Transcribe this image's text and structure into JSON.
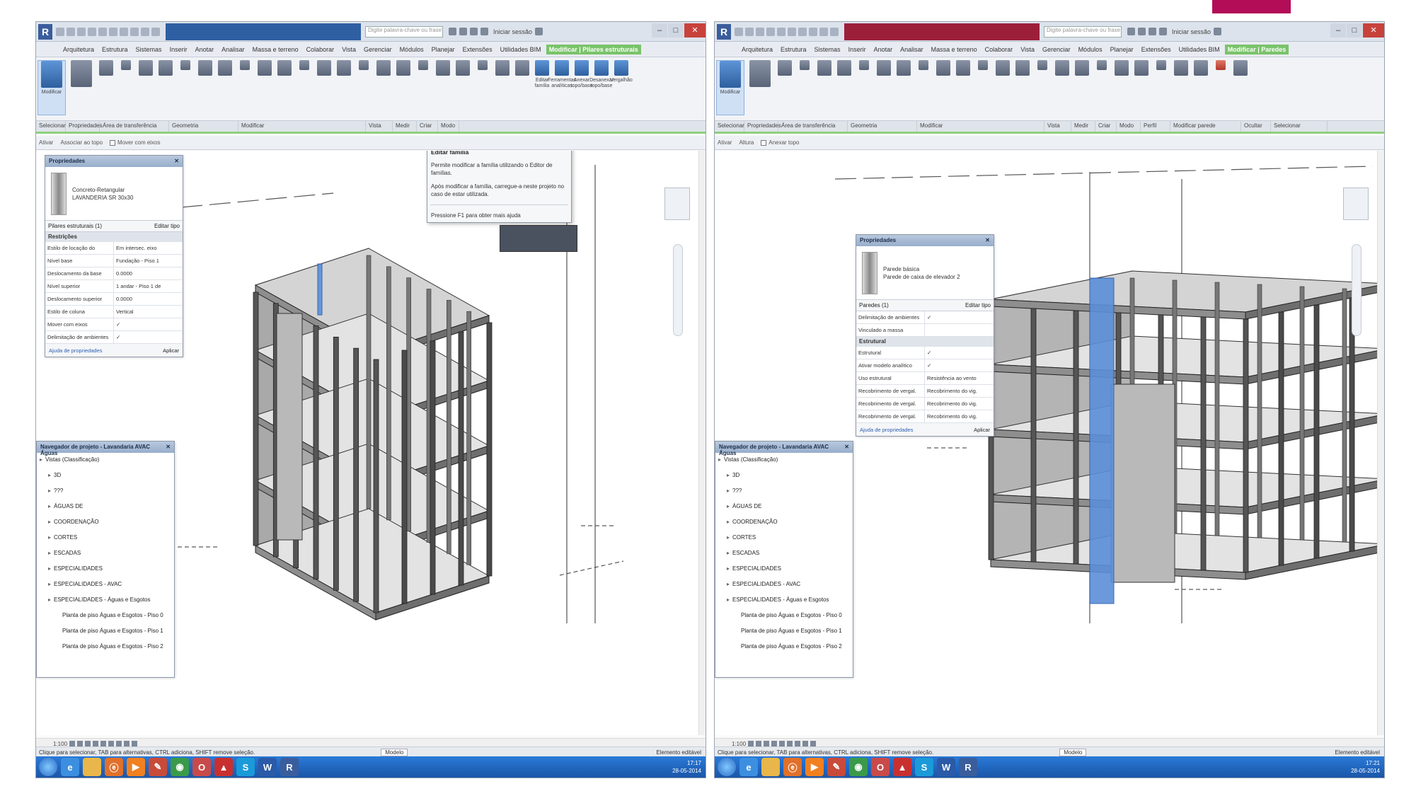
{
  "colors": {
    "accent_rect": "#b30d57",
    "doc_title_left": "#2f5fa3",
    "doc_title_right": "#9c1f3a",
    "selected_blue": "#5b8fd9",
    "context_tab": "#7ac36a"
  },
  "left": {
    "window": {
      "doc_title": "",
      "search_placeholder": "Digite palavra-chave ou frase",
      "user": "Iniciar sessão"
    },
    "ribbon": {
      "tabs": [
        "Arquitetura",
        "Estrutura",
        "Sistemas",
        "Inserir",
        "Anotar",
        "Analisar",
        "Massa e terreno",
        "Colaborar",
        "Vista",
        "Gerenciar",
        "Módulos",
        "Planejar",
        "Extensões",
        "Utilidades BIM",
        "Modificar | Pilares estruturais"
      ],
      "panels": [
        "Selecionar",
        "Propriedades",
        "Área de transferência",
        "Geometria",
        "Modificar",
        "Vista",
        "Medir",
        "Criar",
        "Modo"
      ],
      "tools": {
        "modify": "Modificar",
        "edit_family": "Editar família",
        "edit_analytical": "Ferramentas analíticas",
        "attach_base": "Anexar topo/base",
        "detach_base": "Desanexar topo/base",
        "hangers": "Vergalhão"
      }
    },
    "options_bar": {
      "ctx1": "Ativar",
      "ctx2": "Associar ao topo",
      "check": "Mover com eixos"
    },
    "properties": {
      "title": "Propriedades",
      "type_name_line1": "Concreto-Retangular",
      "type_name_line2": "LAVANDERIA SR 30x30",
      "filter_label": "Pilares estruturais (1)",
      "edit_type": "Editar tipo",
      "section": "Restrições",
      "rows": [
        {
          "k": "Estilo de locação do",
          "v": "Em intersec. eixo"
        },
        {
          "k": "Nível base",
          "v": "Fundação - Piso 1"
        },
        {
          "k": "Deslocamento da base",
          "v": "0.0000"
        },
        {
          "k": "Nível superior",
          "v": "1 andar - Piso 1 de"
        },
        {
          "k": "Deslocamento superior",
          "v": "0.0000"
        },
        {
          "k": "Estilo de coluna",
          "v": "Vertical"
        },
        {
          "k": "Mover com eixos",
          "v": "✓"
        },
        {
          "k": "Delimitação de ambientes",
          "v": "✓"
        }
      ],
      "help_link": "Ajuda de propriedades",
      "apply": "Aplicar"
    },
    "browser": {
      "title": "Navegador de projeto - Lavandaria AVAC Águas",
      "items": [
        {
          "indent": 0,
          "label": "Vistas (Classificação)"
        },
        {
          "indent": 1,
          "label": "3D"
        },
        {
          "indent": 1,
          "label": "???"
        },
        {
          "indent": 1,
          "label": "ÁGUAS DE"
        },
        {
          "indent": 1,
          "label": "COORDENAÇÃO"
        },
        {
          "indent": 1,
          "label": "CORTES"
        },
        {
          "indent": 1,
          "label": "ESCADAS"
        },
        {
          "indent": 1,
          "label": "ESPECIALIDADES"
        },
        {
          "indent": 1,
          "label": "ESPECIALIDADES - AVAC"
        },
        {
          "indent": 1,
          "label": "ESPECIALIDADES - Águas e Esgotos"
        },
        {
          "indent": 2,
          "label": "Planta de piso Águas e Esgotos - Piso 0"
        },
        {
          "indent": 2,
          "label": "Planta de piso Águas e Esgotos - Piso 1"
        },
        {
          "indent": 2,
          "label": "Planta de piso Águas e Esgotos - Piso 2"
        }
      ]
    },
    "tooltip": {
      "title": "Editar família",
      "line1": "Permite modificar a família utilizando o Editor de famílias.",
      "line2": "Após modificar a família, carregue-a neste projeto no caso de estar utilizada.",
      "line3": "Pressione F1 para obter mais ajuda"
    },
    "status": {
      "text": "Clique para selecionar, TAB para alternativas, CTRL adiciona, SHIFT remove seleção.",
      "model": "Modelo",
      "filter": "Elemento editável"
    },
    "clock": {
      "time": "17:17",
      "date": "28-05-2014"
    }
  },
  "right": {
    "window": {
      "doc_title": "",
      "search_placeholder": "Digite palavra-chave ou frase",
      "user": "Iniciar sessão"
    },
    "ribbon": {
      "tabs": [
        "Arquitetura",
        "Estrutura",
        "Sistemas",
        "Inserir",
        "Anotar",
        "Analisar",
        "Massa e terreno",
        "Colaborar",
        "Vista",
        "Gerenciar",
        "Módulos",
        "Planejar",
        "Extensões",
        "Utilidades BIM",
        "Modificar | Paredes"
      ],
      "panels": [
        "Selecionar",
        "Propriedades",
        "Área de transferência",
        "Geometria",
        "Modificar",
        "Vista",
        "Medir",
        "Criar",
        "Modo",
        "Perfil",
        "Modificar parede",
        "Ocultar",
        "Selecionar"
      ],
      "tools": {
        "modify": "Modificar"
      }
    },
    "options_bar": {
      "ctx1": "Ativar",
      "ctx2": "Altura",
      "check": "Anexar topo"
    },
    "properties": {
      "title": "Propriedades",
      "type_name_line1": "Parede básica",
      "type_name_line2": "Parede de caixa de elevador 2",
      "filter_label": "Paredes (1)",
      "edit_type": "Editar tipo",
      "rows_top": [
        {
          "k": "Delimitação de ambientes",
          "v": "✓"
        },
        {
          "k": "Vinculado a massa",
          "v": ""
        }
      ],
      "section": "Estrutural",
      "rows": [
        {
          "k": "Estrutural",
          "v": "✓"
        },
        {
          "k": "Ativar modelo analítico",
          "v": "✓"
        },
        {
          "k": "Uso estrutural",
          "v": "Resistência ao vento"
        },
        {
          "k": "Recobrimento de vergal.",
          "v": "Recobrimento do vig."
        },
        {
          "k": "Recobrimento de vergal.",
          "v": "Recobrimento do vig."
        },
        {
          "k": "Recobrimento de vergal.",
          "v": "Recobrimento do vig."
        }
      ],
      "help_link": "Ajuda de propriedades",
      "apply": "Aplicar"
    },
    "browser": {
      "title": "Navegador de projeto - Lavandaria AVAC Águas",
      "items": [
        {
          "indent": 0,
          "label": "Vistas (Classificação)"
        },
        {
          "indent": 1,
          "label": "3D"
        },
        {
          "indent": 1,
          "label": "???"
        },
        {
          "indent": 1,
          "label": "ÁGUAS DE"
        },
        {
          "indent": 1,
          "label": "COORDENAÇÃO"
        },
        {
          "indent": 1,
          "label": "CORTES"
        },
        {
          "indent": 1,
          "label": "ESCADAS"
        },
        {
          "indent": 1,
          "label": "ESPECIALIDADES"
        },
        {
          "indent": 1,
          "label": "ESPECIALIDADES - AVAC"
        },
        {
          "indent": 1,
          "label": "ESPECIALIDADES - Águas e Esgotos"
        },
        {
          "indent": 2,
          "label": "Planta de piso Águas e Esgotos - Piso 0"
        },
        {
          "indent": 2,
          "label": "Planta de piso Águas e Esgotos - Piso 1"
        },
        {
          "indent": 2,
          "label": "Planta de piso Águas e Esgotos - Piso 2"
        }
      ]
    },
    "status": {
      "text": "Clique para selecionar, TAB para alternativas, CTRL adiciona, SHIFT remove seleção.",
      "model": "Modelo",
      "filter": "Elemento editável"
    },
    "clock": {
      "time": "17:21",
      "date": "28-05-2014"
    }
  },
  "taskbar_icons": [
    "windows-start-icon",
    "internet-explorer-icon",
    "file-explorer-icon",
    "firefox-icon",
    "media-player-icon",
    "paint-icon",
    "chrome-icon",
    "opera-icon",
    "pdf-icon",
    "skype-icon",
    "word-icon",
    "revit-icon"
  ]
}
